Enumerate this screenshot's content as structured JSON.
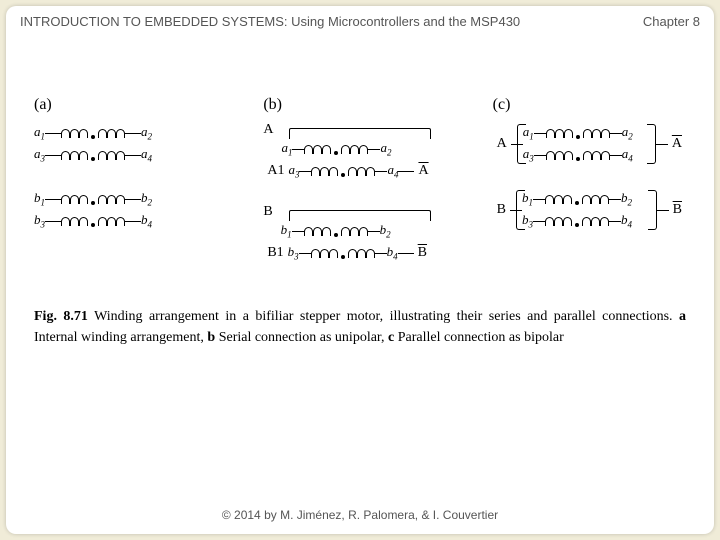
{
  "header": {
    "title": "INTRODUCTION TO EMBEDDED SYSTEMS: Using Microcontrollers and the MSP430",
    "chapter": "Chapter 8"
  },
  "footer": {
    "copyright": "© 2014 by M. Jiménez, R. Palomera, & I. Couvertier"
  },
  "panels": {
    "a": {
      "label": "(a)"
    },
    "b": {
      "label": "(b)",
      "termA": "A",
      "termA1": "A1",
      "termAbar": "A",
      "termB": "B",
      "termB1": "B1",
      "termBbar": "B"
    },
    "c": {
      "label": "(c)",
      "termA": "A",
      "termAbar": "A",
      "termB": "B",
      "termBbar": "B"
    }
  },
  "wind": {
    "a1": "a",
    "a1s": "1",
    "a2": "a",
    "a2s": "2",
    "a3": "a",
    "a3s": "3",
    "a4": "a",
    "a4s": "4",
    "b1": "b",
    "b1s": "1",
    "b2": "b",
    "b2s": "2",
    "b3": "b",
    "b3s": "3",
    "b4": "b",
    "b4s": "4"
  },
  "caption": {
    "lead": "Fig. 8.71",
    "text1": "  Winding arrangement in a bifiliar stepper motor, illustrating their series and parallel connections. ",
    "pa": "a",
    "ta": " Internal winding arrangement, ",
    "pb": "b",
    "tb": " Serial connection as unipolar, ",
    "pc": "c",
    "tc": " Parallel connection as bipolar"
  }
}
